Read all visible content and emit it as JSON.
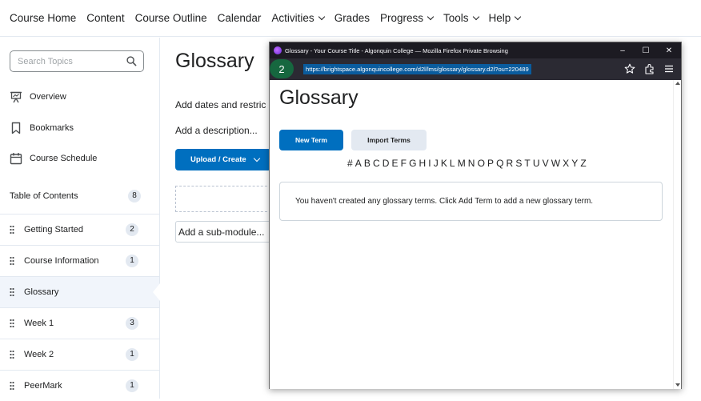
{
  "topnav": {
    "items": [
      {
        "label": "Course Home",
        "dropdown": false
      },
      {
        "label": "Content",
        "dropdown": false
      },
      {
        "label": "Course Outline",
        "dropdown": false
      },
      {
        "label": "Calendar",
        "dropdown": false
      },
      {
        "label": "Activities",
        "dropdown": true
      },
      {
        "label": "Grades",
        "dropdown": false
      },
      {
        "label": "Progress",
        "dropdown": true
      },
      {
        "label": "Tools",
        "dropdown": true
      },
      {
        "label": "Help",
        "dropdown": true
      }
    ]
  },
  "sidebar": {
    "search_placeholder": "Search Topics",
    "links": [
      {
        "label": "Overview",
        "icon": "presentation-icon"
      },
      {
        "label": "Bookmarks",
        "icon": "bookmark-icon"
      },
      {
        "label": "Course Schedule",
        "icon": "calendar-icon"
      }
    ],
    "toc_label": "Table of Contents",
    "toc_count": "8",
    "modules": [
      {
        "label": "Getting Started",
        "count": "2",
        "active": false
      },
      {
        "label": "Course Information",
        "count": "1",
        "active": false
      },
      {
        "label": "Glossary",
        "count": "",
        "active": true
      },
      {
        "label": "Week 1",
        "count": "3",
        "active": false
      },
      {
        "label": "Week 2",
        "count": "1",
        "active": false
      },
      {
        "label": "PeerMark",
        "count": "1",
        "active": false
      }
    ]
  },
  "main": {
    "title": "Glossary",
    "dates_text": "Add dates and restric",
    "description_text": "Add a description...",
    "upload_label": "Upload / Create",
    "submodule_placeholder": "Add a sub-module..."
  },
  "browser": {
    "window_title": "Glossary - Your Course Title - Algonquin College — Mozilla Firefox Private Browsing",
    "url": "https://brightspace.algonquincollege.com/d2l/lms/glossary/glossary.d2l?ou=220489",
    "step_number": "2",
    "minimize": "–",
    "maximize": "☐",
    "close": "✕"
  },
  "glossary": {
    "title": "Glossary",
    "new_term_label": "New Term",
    "import_terms_label": "Import Terms",
    "alphabet": [
      "#",
      "A",
      "B",
      "C",
      "D",
      "E",
      "F",
      "G",
      "H",
      "I",
      "J",
      "K",
      "L",
      "M",
      "N",
      "O",
      "P",
      "Q",
      "R",
      "S",
      "T",
      "U",
      "V",
      "W",
      "X",
      "Y",
      "Z"
    ],
    "empty_message": "You haven't created any glossary terms. Click Add Term to add a new glossary term."
  },
  "colors": {
    "primary_blue": "#006fbf",
    "step_badge_green": "#16673f",
    "firefox_chrome": "#1c1b22"
  }
}
